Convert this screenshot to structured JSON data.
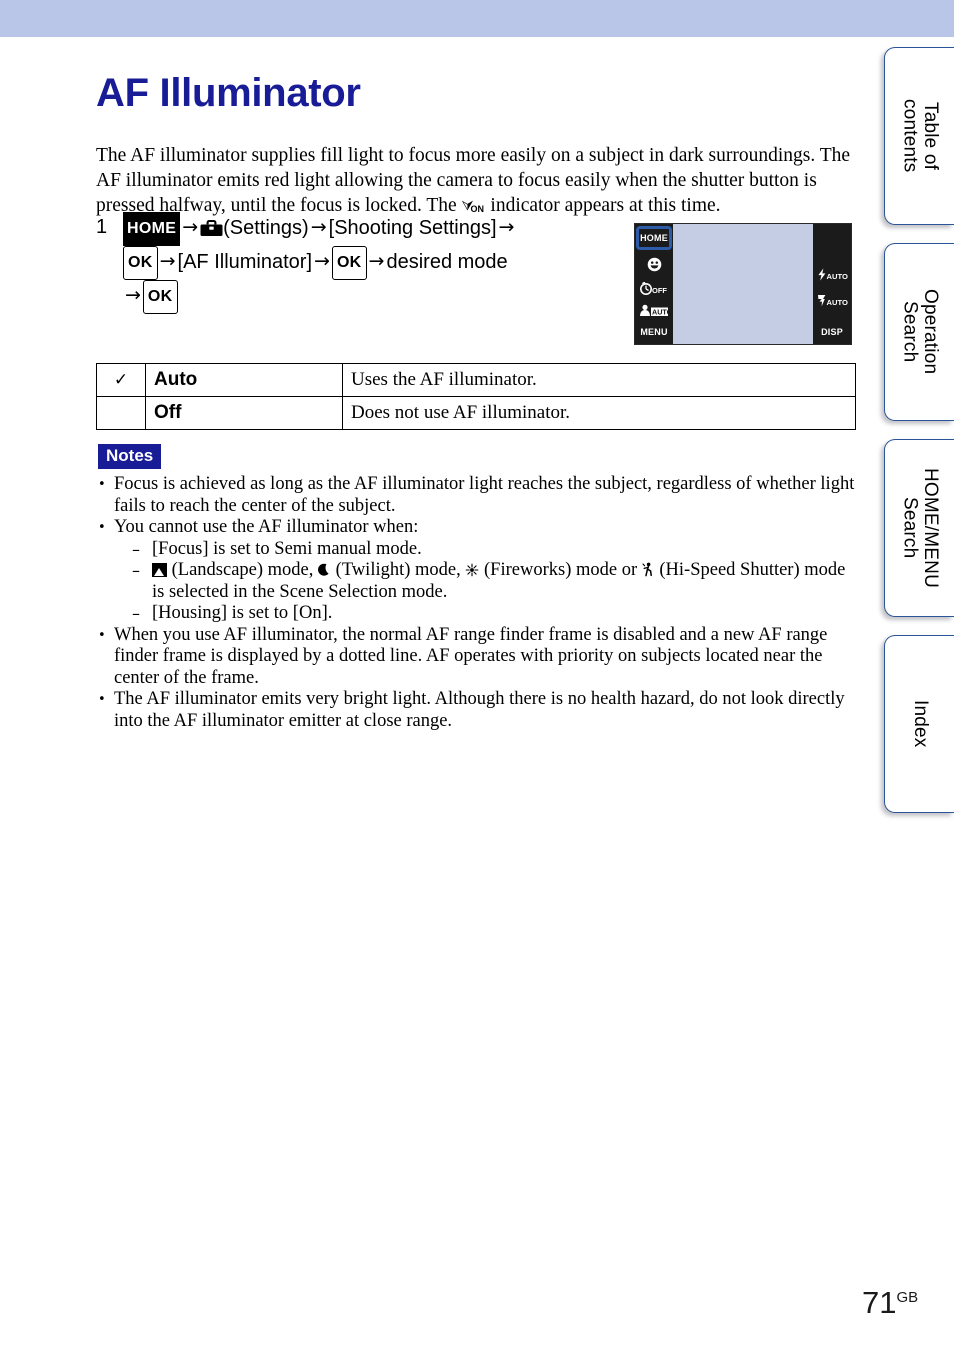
{
  "header": {
    "band_color": "#b9c6e8"
  },
  "side_tabs": [
    {
      "label": "Table of\ncontents"
    },
    {
      "label": "Operation\nSearch"
    },
    {
      "label": "HOME/MENU\nSearch"
    },
    {
      "label": "Index"
    }
  ],
  "page": {
    "title": "AF Illuminator",
    "title_color": "#181c96",
    "number": "71",
    "number_suffix": "GB"
  },
  "intro": {
    "part1": "The AF illuminator supplies fill light to focus more easily on a subject in dark surroundings. The AF illuminator emits red light allowing the camera to focus easily when the shutter button is pressed halfway, until the focus is locked. The ",
    "indicator_icon": "af-illuminator-on-icon",
    "indicator_bolt": "⮛",
    "indicator_label": "ON",
    "part2": " indicator appears at this time."
  },
  "step": {
    "number": "1",
    "home_badge": "HOME",
    "arrow": "→",
    "settings_icon": "toolbox-settings-icon",
    "settings_label": "(Settings)",
    "shooting_settings": "[Shooting Settings]",
    "ok_badge_1": "OK",
    "af_illuminator": "[AF Illuminator]",
    "ok_badge_2": "OK",
    "desired_mode": "desired mode",
    "ok_badge_3": "OK"
  },
  "lcd": {
    "screen_color": "#c5cde4",
    "bar_color": "#1b1b1b",
    "highlight_color": "#2d5ba8",
    "left_items": [
      {
        "name": "home-button",
        "label": "HOME",
        "type": "text-highlight"
      },
      {
        "name": "smile-shutter-icon",
        "label": "☺",
        "type": "glyph"
      },
      {
        "name": "self-timer-off-icon",
        "label": "OFF",
        "type": "glyph-label"
      },
      {
        "name": "face-detection-auto-icon",
        "label": "AUTO",
        "type": "glyph-label"
      },
      {
        "name": "menu-button",
        "label": "MENU",
        "type": "text"
      }
    ],
    "right_items": [
      {
        "name": "flash-auto-icon",
        "label": "AUTO",
        "glyph": "⚡"
      },
      {
        "name": "macro-auto-icon",
        "label": "AUTO",
        "glyph": "❁"
      },
      {
        "name": "disp-button",
        "label": "DISP",
        "glyph": ""
      }
    ]
  },
  "options_table": {
    "rows": [
      {
        "checked": true,
        "check_glyph": "✓",
        "name": "Auto",
        "description": "Uses the AF illuminator."
      },
      {
        "checked": false,
        "check_glyph": "",
        "name": "Off",
        "description": "Does not use AF illuminator."
      }
    ]
  },
  "notes": {
    "badge": "Notes",
    "badge_color": "#181c96",
    "items": [
      {
        "text": "Focus is achieved as long as the AF illuminator light reaches the subject, regardless of whether light fails to reach the center of the subject.",
        "sub": []
      },
      {
        "text": "You cannot use the AF illuminator when:",
        "sub": [
          {
            "kind": "plain",
            "text": "[Focus] is set to Semi manual mode."
          },
          {
            "kind": "icons",
            "prefix": "",
            "seg1": " (Landscape) mode, ",
            "seg2": " (Twilight) mode, ",
            "seg3": " (Fireworks) mode or ",
            "seg4": " (Hi-Speed Shutter) mode is selected in the Scene Selection mode.",
            "icon1": "landscape-mode-icon",
            "icon2": "twilight-mode-icon",
            "icon2_glyph": "☽",
            "icon3": "fireworks-mode-icon",
            "icon3_glyph": "✸",
            "icon4": "hi-speed-shutter-mode-icon",
            "icon4_glyph": "Ἴ3"
          },
          {
            "kind": "plain",
            "text": "[Housing] is set to [On]."
          }
        ]
      },
      {
        "text": "When you use AF illuminator, the normal AF range finder frame is disabled and a new AF range finder frame is displayed by a dotted line. AF operates with priority on subjects located near the center of the frame.",
        "sub": []
      },
      {
        "text": "The AF illuminator emits very bright light. Although there is no health hazard, do not look directly into the AF illuminator emitter at close range.",
        "sub": []
      }
    ]
  }
}
